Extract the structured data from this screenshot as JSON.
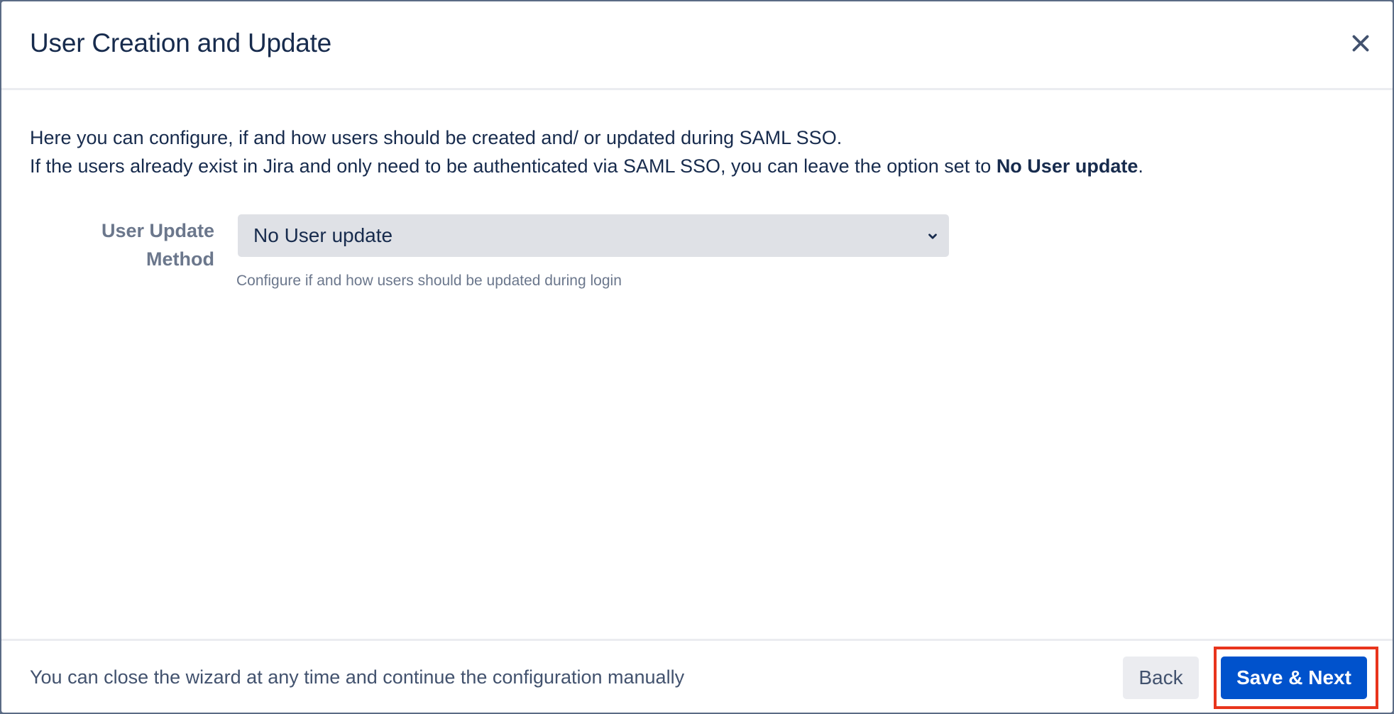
{
  "dialog": {
    "title": "User Creation and Update",
    "close_icon": "close-icon"
  },
  "intro": {
    "line1": "Here you can configure, if and how users should be created and/ or updated during SAML SSO.",
    "line2_prefix": "If the users already exist in Jira and only need to be authenticated via SAML SSO, you can leave the option set to ",
    "line2_bold": "No User update",
    "line2_suffix": "."
  },
  "user_update_method": {
    "label_line1": "User Update",
    "label_line2": "Method",
    "selected_value": "No User update",
    "help_text": "Configure if and how users should be updated during login",
    "chevron_icon": "chevron-down-icon"
  },
  "footer": {
    "note": "You can close the wizard at any time and continue the configuration manually",
    "back_label": "Back",
    "save_next_label": "Save & Next"
  },
  "colors": {
    "primary": "#0052cc",
    "text": "#172b4d",
    "subtle_text": "#6b778c",
    "highlight": "#e8341c"
  }
}
